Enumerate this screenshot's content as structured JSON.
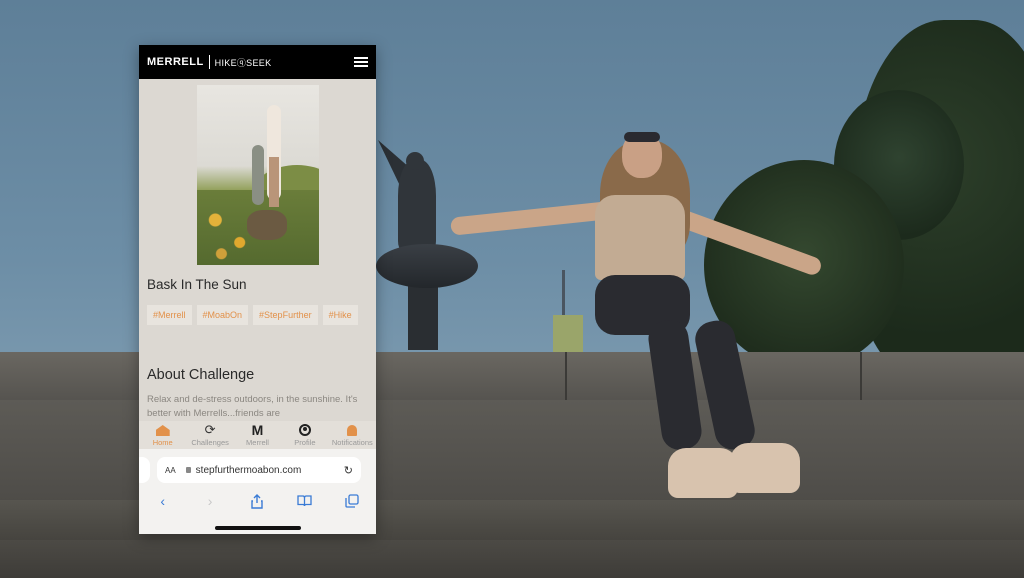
{
  "header": {
    "brand": "MERRELL",
    "partner": "HIKEⓠSEEK",
    "menu_icon": "hamburger-menu-icon"
  },
  "post": {
    "title": "Bask In The Sun",
    "tags": [
      "#Merrell",
      "#MoabOn",
      "#StepFurther",
      "#Hike"
    ]
  },
  "about": {
    "title": "About Challenge",
    "text": "Relax and de-stress outdoors, in the sunshine. It's better with Merrells...friends are"
  },
  "tabbar": {
    "active": "Home",
    "tabs": [
      {
        "label": "Home",
        "icon": "home-icon"
      },
      {
        "label": "Challenges",
        "icon": "refresh-icon"
      },
      {
        "label": "Merrell",
        "icon": "merrell-m-icon"
      },
      {
        "label": "Profile",
        "icon": "profile-icon"
      },
      {
        "label": "Notifications",
        "icon": "bell-icon"
      }
    ]
  },
  "browser": {
    "text_size_label": "AA",
    "url": "stepfurthermoabon.com",
    "toolbar_icons": [
      "back-icon",
      "forward-icon",
      "share-icon",
      "bookmarks-icon",
      "tabs-icon"
    ]
  },
  "colors": {
    "accent": "#e2914a",
    "header_bg": "#000000",
    "page_bg": "#dcd8d2",
    "ios_blue": "#3a7bd5"
  }
}
